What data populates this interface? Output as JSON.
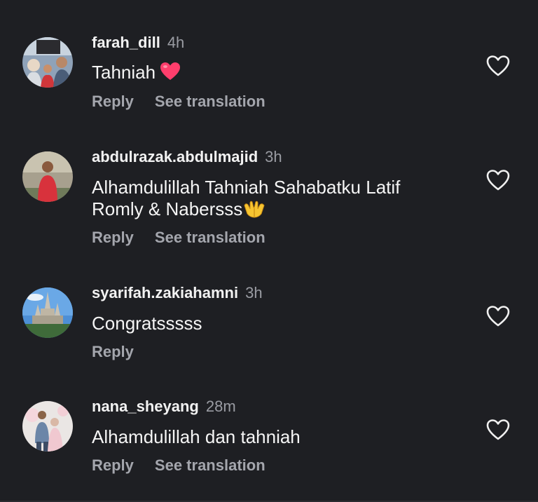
{
  "comments": [
    {
      "username": "farah_dill",
      "time": "4h",
      "text": "Tahniah",
      "emoji": "red-heart",
      "actions": [
        "Reply",
        "See translation"
      ],
      "avatar": "family-photo-avatar"
    },
    {
      "username": "abdulrazak.abdulmajid",
      "time": "3h",
      "text_line1": "Alhamdulillah Tahniah Sahabatku Latif",
      "text_line2": "Romly & Nabersss",
      "emoji": "palms-up-together",
      "actions": [
        "Reply",
        "See translation"
      ],
      "avatar": "person-in-red-avatar"
    },
    {
      "username": "syarifah.zakiahamni",
      "time": "3h",
      "text": "Congratsssss",
      "actions": [
        "Reply"
      ],
      "avatar": "castle-avatar"
    },
    {
      "username": "nana_sheyang",
      "time": "28m",
      "text": "Alhamdulillah dan tahniah",
      "actions": [
        "Reply",
        "See translation"
      ],
      "avatar": "couple-photo-avatar"
    }
  ],
  "colors": {
    "background": "#1e1f23",
    "username": "#f2f2f2",
    "muted": "#9a9ca3",
    "heart_emoji": "#ff3e6c"
  }
}
